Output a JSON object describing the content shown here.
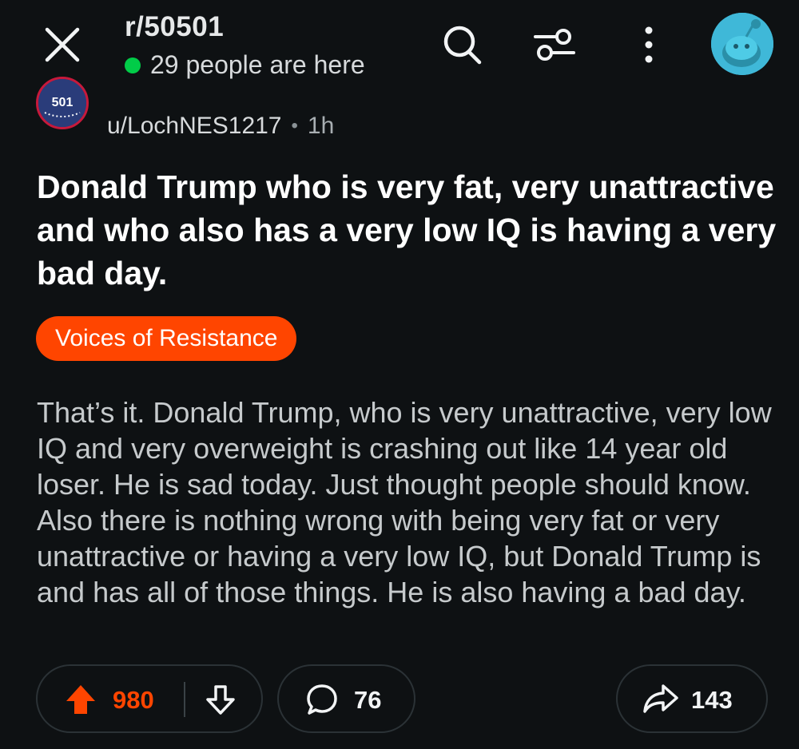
{
  "header": {
    "subreddit": "r/50501",
    "online_text": "29 people are here",
    "icons": [
      "close-icon",
      "search-icon",
      "filter-icon",
      "more-vertical-icon",
      "avatar"
    ]
  },
  "post": {
    "author": "u/LochNES1217",
    "separator": "•",
    "time": "1h",
    "community_icon_text": "501",
    "title": "Donald Trump who is very fat, very unattractive and who also has a very low IQ is having a very bad day.",
    "flair": "Voices of Resistance",
    "body": "That’s it. Donald Trump, who is very unattractive, very low IQ and very overweight is crashing out like 14 year old loser. He is sad today. Just thought people should know. Also there is nothing wrong with being very fat or very unattractive or having a very low IQ, but Donald Trump is and has all of those things. He is also having a bad day."
  },
  "actions": {
    "votes": "980",
    "comments": "76",
    "shares": "143"
  },
  "colors": {
    "background": "#0e1113",
    "accent": "#ff4500",
    "online": "#01cc48"
  }
}
